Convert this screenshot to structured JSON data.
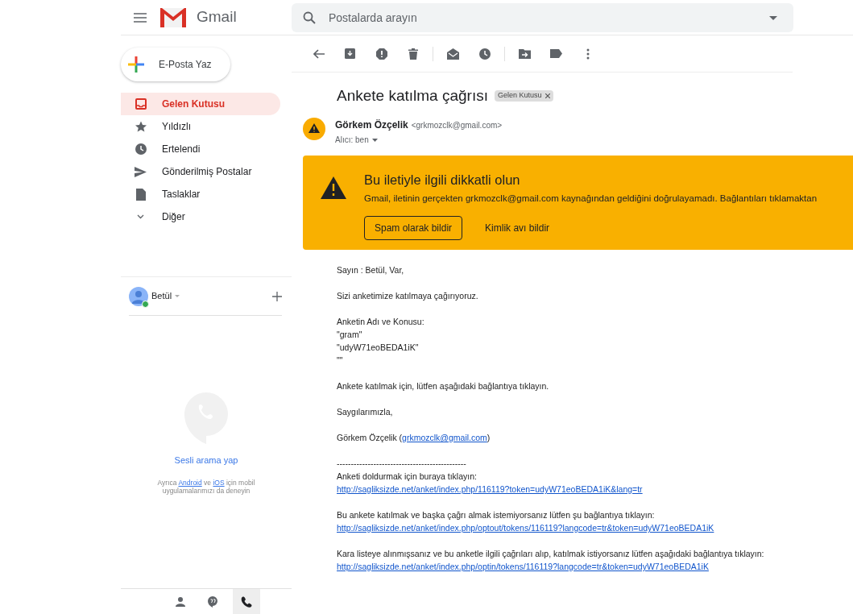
{
  "header": {
    "app_name": "Gmail",
    "search": {
      "placeholder": "Postalarda arayın"
    }
  },
  "compose": {
    "label": "E-Posta Yaz"
  },
  "nav": [
    {
      "label": "Gelen Kutusu",
      "selected": true
    },
    {
      "label": "Yıldızlı",
      "selected": false
    },
    {
      "label": "Ertelendi",
      "selected": false
    },
    {
      "label": "Gönderilmiş Postalar",
      "selected": false
    },
    {
      "label": "Taslaklar",
      "selected": false
    },
    {
      "label": "Diğer",
      "selected": false
    }
  ],
  "hangouts": {
    "user": "Betül",
    "online": true,
    "call_label": "Sesli arama yap",
    "hint": [
      {
        "text": "Ayrıca "
      },
      {
        "text": "Android",
        "link": true
      },
      {
        "text": " ve "
      },
      {
        "text": "iOS",
        "link": true
      },
      {
        "text": " için mobil uygulamalarımızı da deneyin"
      }
    ],
    "tabs": [
      {
        "selected": false
      },
      {
        "selected": false
      },
      {
        "selected": true
      }
    ]
  },
  "message": {
    "subject": "Ankete katılma çağrısı",
    "label_chip": "Gelen Kutusu",
    "sender_name": "Görkem Özçelik",
    "sender_email": "<grkmozclk@gmail.com>",
    "recipient": "Alıcı: ben",
    "warning": {
      "title": "Bu iletiyle ilgili dikkatli olun",
      "text": "Gmail, iletinin gerçekten grkmozclk@gmail.com kaynağından geldiğini doğrulayamadı. Bağlantıları tıklamaktan",
      "buttons": [
        {
          "label": "Spam olarak bildir",
          "kind": "outlined"
        },
        {
          "label": "Kimlik avı bildir",
          "kind": "text"
        }
      ]
    },
    "body": [
      [
        [
          {
            "text": "Sayın : Betül, Var,"
          }
        ]
      ],
      [
        [
          {
            "text": "Sizi anketimize katılmaya çağırıyoruz."
          }
        ]
      ],
      [
        [
          {
            "text": "Anketin Adı ve Konusu:"
          }
        ],
        [
          {
            "text": "\"gram\""
          }
        ],
        [
          {
            "text": "\"udyW71eoBEDA1iK\""
          }
        ],
        [
          {
            "text": "\"\""
          }
        ]
      ],
      [
        [
          {
            "text": "Ankete katılmak için, lütfen aşağıdaki bağlantıya tıklayın."
          }
        ]
      ],
      [
        [
          {
            "text": "Saygılarımızla,"
          }
        ]
      ],
      [
        [
          {
            "text": "Görkem Özçelik ("
          },
          {
            "text": "grkmozclk@gmail.com",
            "link": true
          },
          {
            "text": ")"
          }
        ]
      ],
      [
        [
          {
            "text": "----------------------------------------------"
          }
        ],
        [
          {
            "text": "Anketi doldurmak için buraya tıklayın:"
          }
        ],
        [
          {
            "text": "http://sagliksizde.net/anket/index.php/116119?token=udyW71eoBEDA1iK&lang=tr",
            "link": true
          }
        ]
      ],
      [
        [
          {
            "text": "Bu ankete katılmak ve başka çağrı almak istemiyorsanız lütfen şu bağlantıya tıklayın:"
          }
        ],
        [
          {
            "text": "http://sagliksizde.net/anket/index.php/optout/tokens/116119?langcode=tr&token=udyW71eoBEDA1iK",
            "link": true
          }
        ]
      ],
      [
        [
          {
            "text": "Kara listeye alınmışsanız ve bu anketle ilgili çağrıları alıp, katılmak istiyorsanız lütfen aşağıdaki bağlantıya tıklayın:"
          }
        ],
        [
          {
            "text": "http://sagliksizde.net/anket/index.php/optin/tokens/116119?langcode=tr&token=udyW71eoBEDA1iK",
            "link": true
          }
        ]
      ]
    ]
  }
}
